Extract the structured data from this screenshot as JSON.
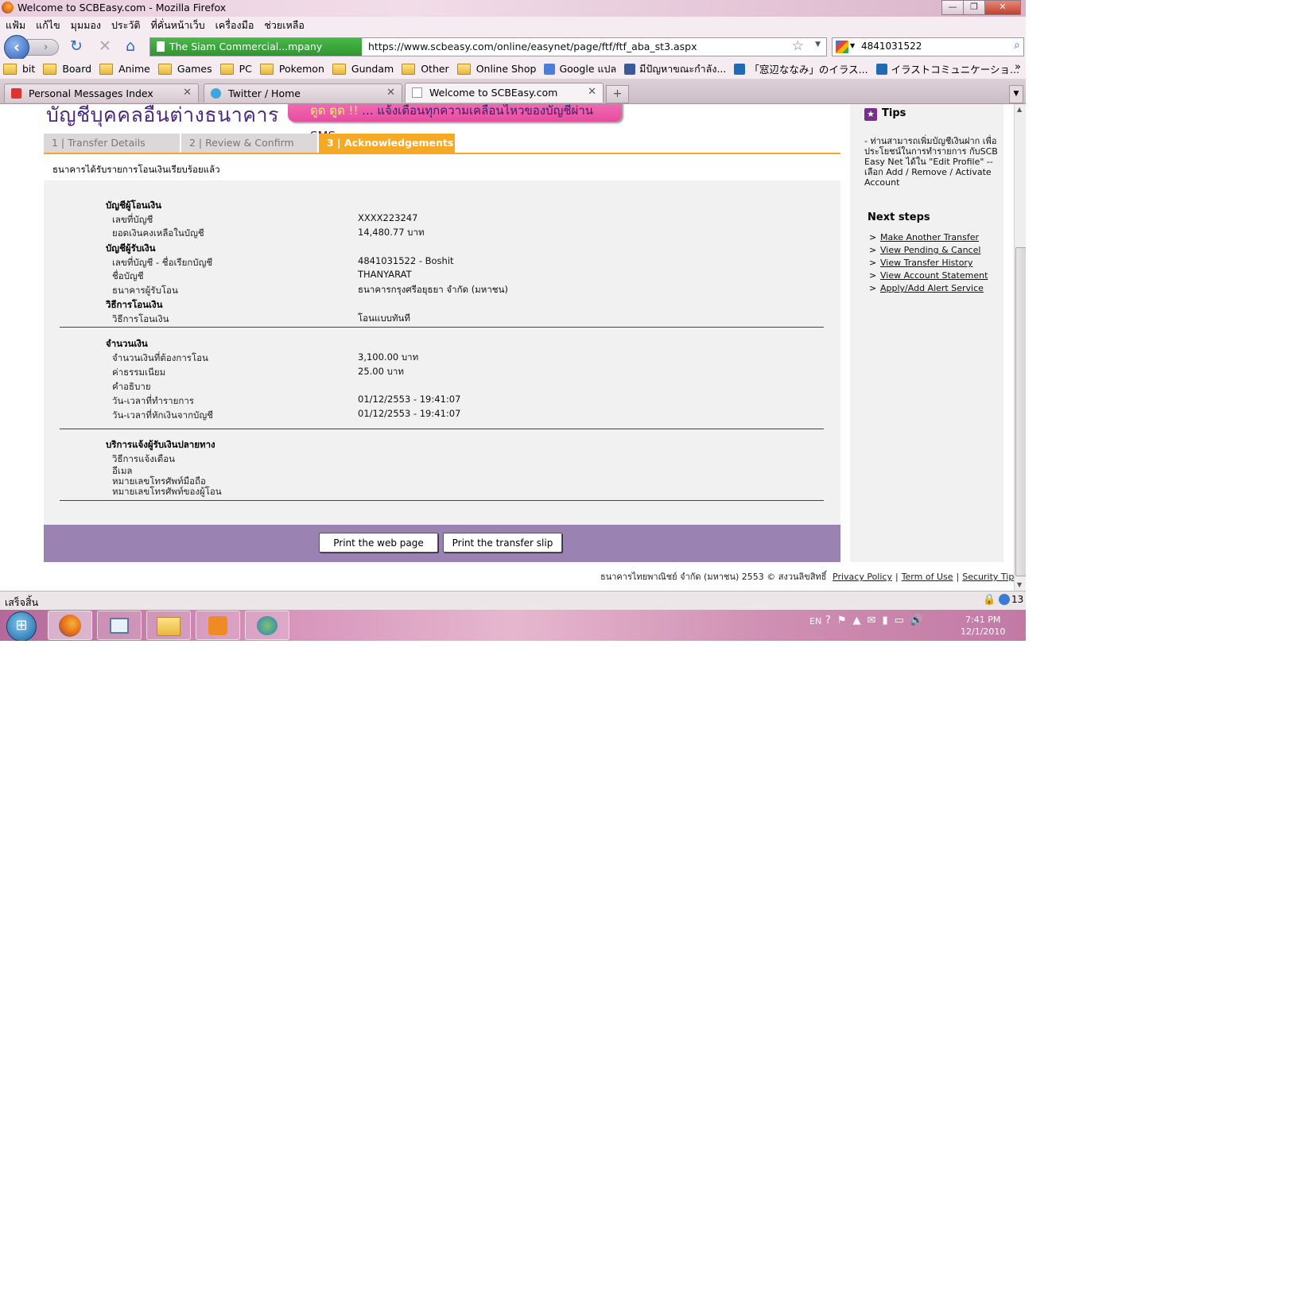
{
  "window": {
    "title": "Welcome to SCBEasy.com - Mozilla Firefox",
    "buttons": {
      "minimize": "—",
      "maximize": "❐",
      "close": "✕"
    }
  },
  "menu": [
    "แฟ้ม",
    "แก้ไข",
    "มุมมอง",
    "ประวัติ",
    "ที่คั่นหน้าเว็บ",
    "เครื่องมือ",
    "ช่วยเหลือ"
  ],
  "nav": {
    "site_identity": "The Siam Commercial...mpany Limited (TH)",
    "url": "https://www.scbeasy.com/online/easynet/page/ftf/ftf_aba_st3.aspx",
    "search_value": "4841031522"
  },
  "bookmarks": [
    {
      "label": "bit",
      "type": "folder"
    },
    {
      "label": "Board",
      "type": "folder"
    },
    {
      "label": "Anime",
      "type": "folder"
    },
    {
      "label": "Games",
      "type": "folder"
    },
    {
      "label": "PC",
      "type": "folder"
    },
    {
      "label": "Pokemon",
      "type": "folder"
    },
    {
      "label": "Gundam",
      "type": "folder"
    },
    {
      "label": "Other",
      "type": "folder"
    },
    {
      "label": "Online Shop",
      "type": "folder"
    },
    {
      "label": "Google แปล",
      "type": "translate"
    },
    {
      "label": "มีปัญหาขณะกำลัง...",
      "type": "facebook"
    },
    {
      "label": "「窓辺ななみ」のイラス...",
      "type": "pixiv"
    },
    {
      "label": "イラストコミュニケーショ...",
      "type": "pixiv"
    }
  ],
  "tabs": [
    {
      "label": "Personal Messages Index",
      "active": false
    },
    {
      "label": "Twitter / Home",
      "active": false
    },
    {
      "label": "Welcome to SCBEasy.com",
      "active": true
    }
  ],
  "page": {
    "heading": "บัญชีบุคคลอื่นต่างธนาคาร",
    "promo_highlight": "ดูด ดูด !!",
    "promo_text": " ... แจ้งเตือนทุกความเคลื่อนไหวของบัญชีผ่าน SMS",
    "steps": [
      "1 | Transfer Details",
      "2 | Review & Confirm",
      "3 | Acknowledgements"
    ],
    "ack_message": "ธนาคารได้รับรายการโอนเงินเรียบร้อยแล้ว",
    "sections": {
      "from_account": "บัญชีผู้โอนเงิน",
      "to_account": "บัญชีผู้รับเงิน",
      "method": "วิธีการโอนเงิน",
      "amount": "จำนวนเงิน",
      "notify": "บริการแจ้งผู้รับเงินปลายทาง"
    },
    "rows": {
      "from_acct_no_label": "เลขที่บัญชี",
      "from_acct_no": "XXXX223247",
      "balance_label": "ยอดเงินคงเหลือในบัญชี",
      "balance": "14,480.77 บาท",
      "to_acct_label": "เลขที่บัญชี - ชื่อเรียกบัญชี",
      "to_acct": "4841031522 - Boshit",
      "acct_name_label": "ชื่อบัญชี",
      "acct_name": "THANYARAT",
      "bank_label": "ธนาคารผู้รับโอน",
      "bank": "ธนาคารกรุงศรีอยุธยา จำกัด (มหาชน)",
      "method_label": "วิธีการโอนเงิน",
      "method": "โอนแบบทันที",
      "amount_label": "จำนวนเงินที่ต้องการโอน",
      "amount": "3,100.00 บาท",
      "fee_label": "ค่าธรรมเนียม",
      "fee": "25.00  บาท",
      "desc_label": "คำอธิบาย",
      "datetime_label": "วัน-เวลาที่ทำรายการ",
      "datetime": "01/12/2553 - 19:41:07",
      "debit_label": "วัน-เวลาที่หักเงินจากบัญชี",
      "debit": "01/12/2553 - 19:41:07",
      "notify_method_label": "วิธีการแจ้งเตือน",
      "email_label": "อีเมล",
      "mobile_label": "หมายเลขโทรศัพท์มือถือ",
      "sender_phone_label": "หมายเลขโทรศัพท์ของผู้โอน"
    },
    "buttons": {
      "print_page": "Print the web page",
      "print_slip": "Print the transfer slip"
    },
    "tips": {
      "title": "Tips",
      "text": "- ท่านสามารถเพิ่มบัญชีเงินฝาก เพื่อประโยชน์ในการทำรายการ กับSCB Easy Net ได้ใน \"Edit Profile\" -- เลือก Add / Remove / Activate Account"
    },
    "next_steps": {
      "title": "Next steps",
      "items": [
        "Make Another Transfer",
        "View Pending & Cancel",
        "View Transfer History",
        "View Account Statement",
        "Apply/Add Alert Service"
      ]
    },
    "footer": {
      "copyright": "ธนาคารไทยพาณิชย์ จำกัด (มหาชน) 2553 © สงวนลิขสิทธิ์",
      "links": [
        "Privacy Policy",
        "Term of Use",
        "Security Tips"
      ]
    }
  },
  "statusbar": {
    "text": "เสร็จสิ้น",
    "count": "13"
  },
  "taskbar": {
    "lang": "EN",
    "time": "7:41 PM",
    "date": "12/1/2010"
  },
  "colors": {
    "accent": "#f6a925",
    "purple_bar": "#9a82b2",
    "heading": "#4b2a82",
    "promo": "#e64c9e"
  }
}
